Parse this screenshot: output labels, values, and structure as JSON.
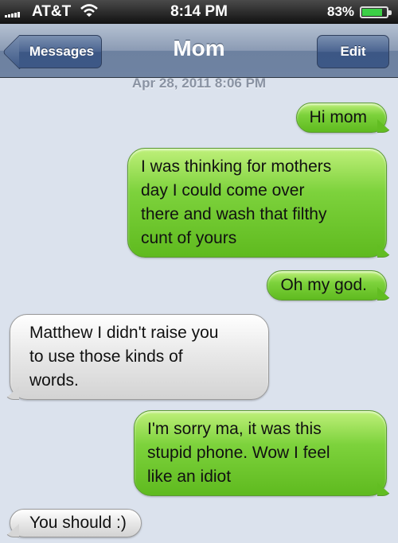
{
  "status_bar": {
    "carrier": "AT&T",
    "time": "8:14 PM",
    "battery_percent": "83%",
    "battery_level": 0.83,
    "signal_icon": "signal-bars-icon",
    "wifi_icon": "wifi-icon",
    "battery_icon": "battery-icon"
  },
  "nav": {
    "back_label": "Messages",
    "title": "Mom",
    "edit_label": "Edit"
  },
  "conversation": {
    "timestamp": "Apr 28, 2011 8:06 PM",
    "messages": [
      {
        "from": "me",
        "text": "Hi mom"
      },
      {
        "from": "me",
        "text": "I was thinking for mothers\nday I could come over\nthere and wash that filthy\ncunt of yours"
      },
      {
        "from": "me",
        "text": "Oh my god."
      },
      {
        "from": "mom",
        "text": "Matthew I didn't raise you\nto use those kinds of\nwords."
      },
      {
        "from": "me",
        "text": "I'm sorry ma, it was this\nstupid phone. Wow I feel\nlike an idiot"
      },
      {
        "from": "mom",
        "text": "You should :)"
      }
    ]
  },
  "colors": {
    "sent_bubble": "#7dd23c",
    "received_bubble": "#e9e9e9",
    "background": "#dbe2ed",
    "nav_bar": "#8b9bb4"
  }
}
